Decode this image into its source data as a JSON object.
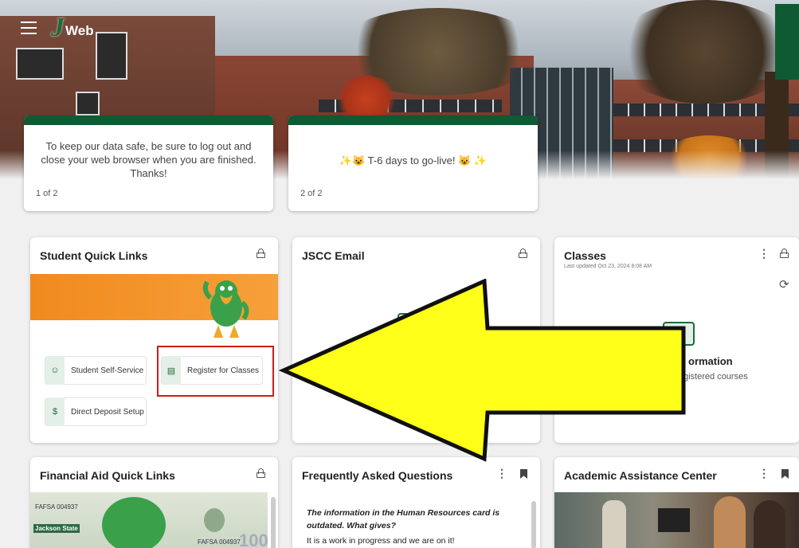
{
  "header": {
    "logo_j": "J",
    "logo_text": "Web"
  },
  "announcements": [
    {
      "message": "To keep our data safe, be sure to log out and close your web browser when you are finished. Thanks!",
      "pager": "1 of 2"
    },
    {
      "message": "✨😺 T-6 days to go-live! 😺 ✨",
      "pager": "2 of 2"
    }
  ],
  "student_quick_links": {
    "title": "Student Quick Links",
    "links": [
      {
        "label": "Student Self-Service",
        "icon": "user-check-icon"
      },
      {
        "label": "Register for Classes",
        "icon": "register-icon"
      },
      {
        "label": "Direct Deposit Setup",
        "icon": "dollar-icon"
      }
    ]
  },
  "jscc_email": {
    "title": "JSCC Email"
  },
  "classes": {
    "title": "Classes",
    "last_updated": "Last updated Oct 23, 2024 8:08 AM",
    "info_title": "ormation",
    "info_text": "gistered courses"
  },
  "financial_aid": {
    "title": "Financial Aid Quick Links",
    "bill_text_1": "FAFSA 004937",
    "bill_text_2": "Jackson State",
    "bill_text_3": "FAFSA 004937",
    "bill_text_4": "100"
  },
  "faq": {
    "title": "Frequently Asked Questions",
    "question": "The information in the Human Resources card is outdated. What gives?",
    "answer": "It is a work in progress and we are on it!"
  },
  "academic_assistance": {
    "title": "Academic Assistance Center"
  },
  "colors": {
    "brand_green": "#0f5a32",
    "accent_orange": "#f08a1e",
    "arrow_yellow": "#ffff1a",
    "highlight_red": "#d11a1a"
  }
}
